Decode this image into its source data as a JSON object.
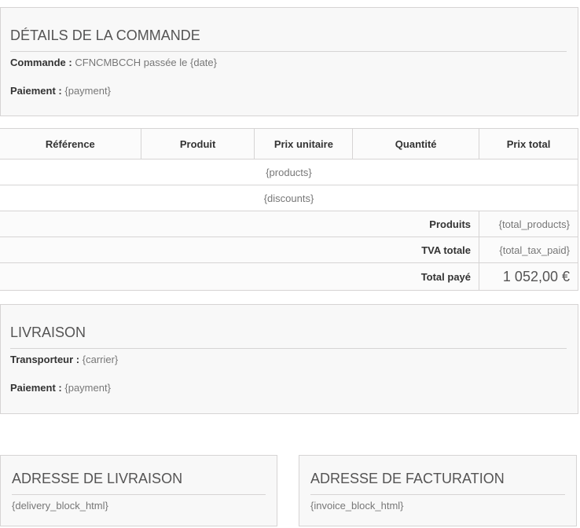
{
  "order_details": {
    "title": "DÉTAILS DE LA COMMANDE",
    "order_label": "Commande :",
    "order_value": "CFNCMBCCH passée le {date}",
    "payment_label": "Paiement :",
    "payment_value": "{payment}"
  },
  "products_table": {
    "headers": [
      "Référence",
      "Produit",
      "Prix unitaire",
      "Quantité",
      "Prix total"
    ],
    "products_placeholder": "{products}",
    "discounts_placeholder": "{discounts}",
    "summary": [
      {
        "label": "Produits",
        "value": "{total_products}"
      },
      {
        "label": "TVA totale",
        "value": "{total_tax_paid}"
      },
      {
        "label": "Total payé",
        "value": "1 052,00 €"
      }
    ]
  },
  "shipping": {
    "title": "LIVRAISON",
    "carrier_label": "Transporteur :",
    "carrier_value": "{carrier}",
    "payment_label": "Paiement :",
    "payment_value": "{payment}"
  },
  "delivery_address": {
    "title": "ADRESSE DE LIVRAISON",
    "value": "{delivery_block_html}"
  },
  "invoice_address": {
    "title": "ADRESSE DE FACTURATION",
    "value": "{invoice_block_html}"
  }
}
